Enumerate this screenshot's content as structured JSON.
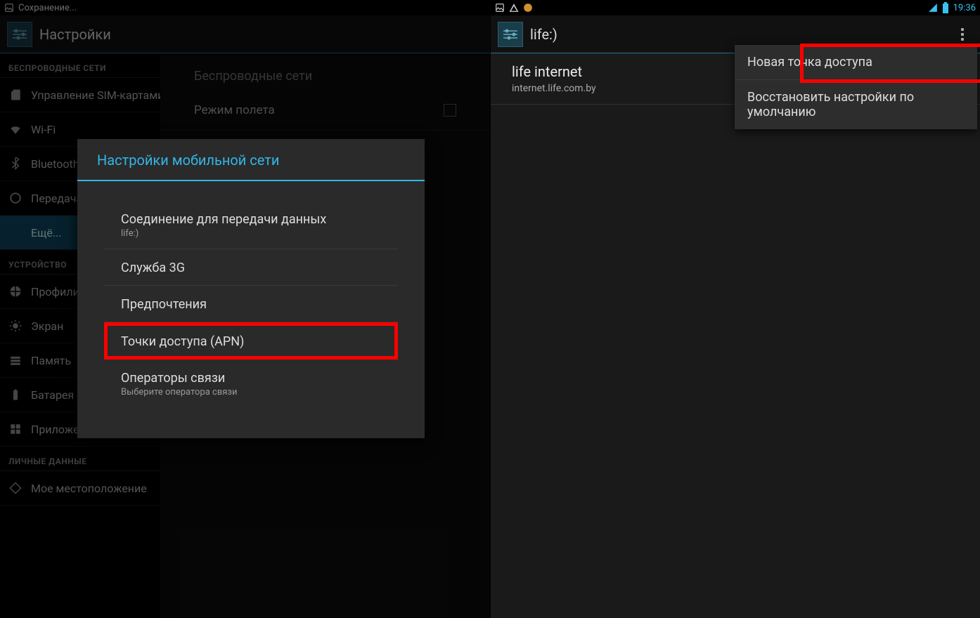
{
  "left": {
    "status": {
      "saving": "Сохранение..."
    },
    "action": {
      "title": "Настройки"
    },
    "sections": {
      "wireless": "БЕСПРОВОДНЫЕ СЕТИ",
      "device": "УСТРОЙСТВО",
      "personal": "ЛИЧНЫЕ ДАННЫЕ"
    },
    "sidebar": {
      "sim": "Управление SIM-картами",
      "wifi": "Wi-Fi",
      "bluetooth": "Bluetooth",
      "data_usage": "Передача данных",
      "more": "Ещё...",
      "profiles": "Профили",
      "display": "Экран",
      "storage": "Память",
      "battery": "Батарея",
      "apps": "Приложения",
      "location": "Мое местоположение"
    },
    "detail": {
      "header": "Беспроводные сети",
      "airplane": "Режим полета"
    },
    "dialog": {
      "title": "Настройки мобильной сети",
      "data_conn": "Соединение для передачи данных",
      "data_conn_sub": "life:)",
      "g3": "Служба 3G",
      "prefs": "Предпочтения",
      "apn": "Точки доступа (APN)",
      "operators": "Операторы связи",
      "operators_sub": "Выберите оператора связи"
    }
  },
  "right": {
    "status": {
      "time": "19:36"
    },
    "action": {
      "title": "life:)"
    },
    "apn": {
      "name": "life internet",
      "url": "internet.life.com.by"
    },
    "popup": {
      "new_apn": "Новая точка доступа",
      "reset": "Восстановить настройки по умолчанию"
    }
  }
}
